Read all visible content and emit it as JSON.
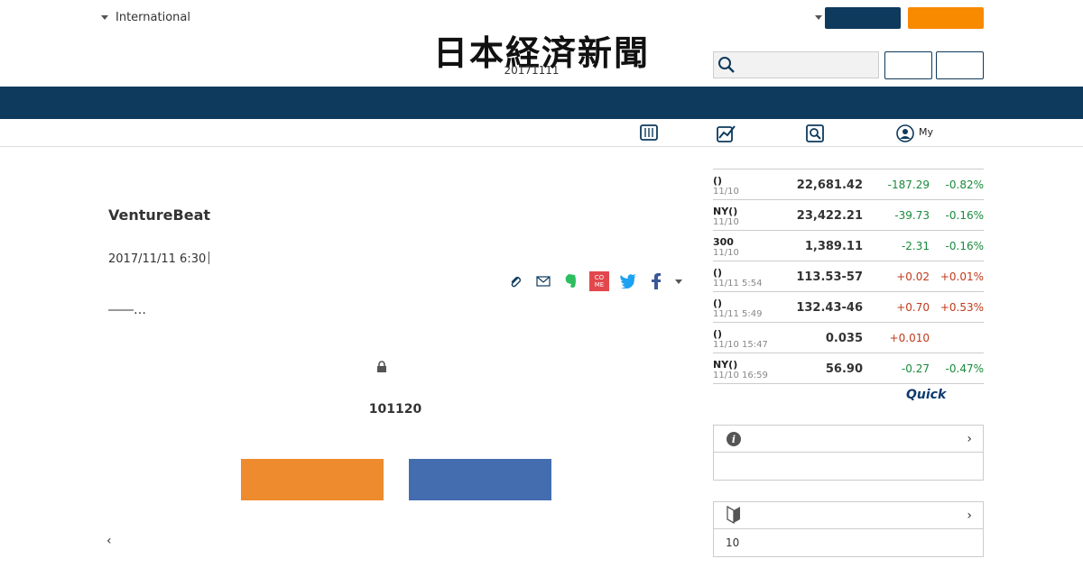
{
  "header": {
    "edition": "International",
    "logo_text": "日本経済新聞",
    "date": "20171111",
    "buttons": {
      "primary": "",
      "highlight": "",
      "outline_1": "",
      "outline_2": ""
    },
    "search": {
      "value": "",
      "placeholder": ""
    },
    "subnav": {
      "my_label": "My",
      "icons": [
        "paper-icon",
        "chart-icon",
        "search-icon",
        "user-icon"
      ]
    }
  },
  "article": {
    "headline": "VentureBeat",
    "published": "2017/11/11 6:30",
    "share_icons": [
      "clip-icon",
      "mail-icon",
      "evernote-icon",
      "come-icon",
      "twitter-icon",
      "facebook-icon",
      "more-icon"
    ],
    "come_label": "CO\nME",
    "lead": "――…",
    "paywall_text": "101120",
    "signup_label": "",
    "login_label": "",
    "back_label": "‹"
  },
  "market": {
    "rows": [
      {
        "name": "()",
        "date": "11/10",
        "value": "22,681.42",
        "change": "-187.29",
        "pct": "-0.82%",
        "dir": "down"
      },
      {
        "name": "NY()",
        "date": "11/10",
        "value": "23,422.21",
        "change": "-39.73",
        "pct": "-0.16%",
        "dir": "down"
      },
      {
        "name": "300",
        "date": "11/10",
        "value": "1,389.11",
        "change": "-2.31",
        "pct": "-0.16%",
        "dir": "down"
      },
      {
        "name": "()",
        "date": "11/11 5:54",
        "value": "113.53-57",
        "change": "+0.02",
        "pct": "+0.01%",
        "dir": "up"
      },
      {
        "name": "()",
        "date": "11/11 5:49",
        "value": "132.43-46",
        "change": "+0.70",
        "pct": "+0.53%",
        "dir": "up"
      },
      {
        "name": "()",
        "date": "11/10 15:47",
        "value": "0.035",
        "change": "+0.010",
        "pct": "",
        "dir": "up"
      },
      {
        "name": "NY()",
        "date": "11/10 16:59",
        "value": "56.90",
        "change": "-0.27",
        "pct": "-0.47%",
        "dir": "down"
      }
    ],
    "source_logo": "Quick"
  },
  "sidebox1": {
    "title": "",
    "body": ""
  },
  "sidebox2": {
    "title": "",
    "body": "10"
  },
  "colors": {
    "navy": "#0d3a5d",
    "orange": "#f88a00",
    "down": "#1a8a3c",
    "up": "#c03a1c",
    "signup": "#ed8b2e",
    "login": "#446db0"
  }
}
